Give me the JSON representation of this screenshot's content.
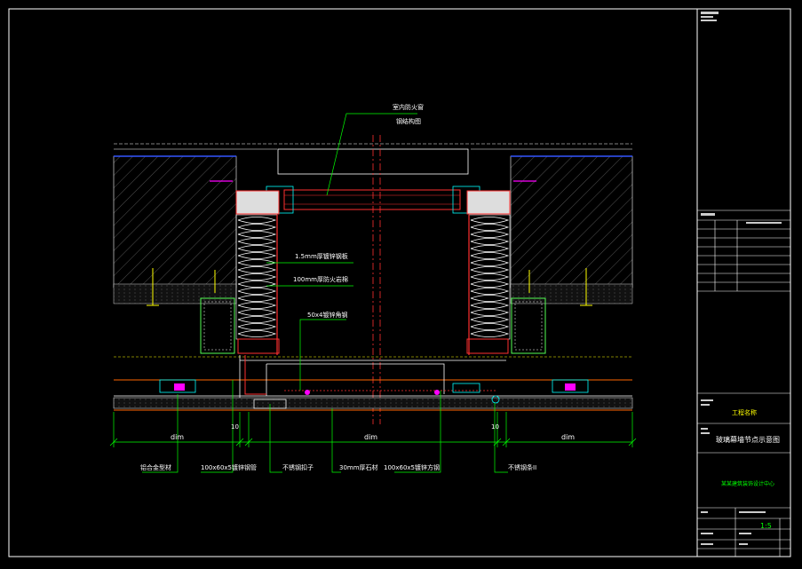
{
  "labels": {
    "top_a": "室内防火窗",
    "top_b": "钢结构图",
    "steel_plate": "1.5mm厚镀锌钢板",
    "fire_cotton": "100mm厚防火岩棉",
    "angle": "50x4镀锌角钢"
  },
  "dims": {
    "left": "dim",
    "mid": "dim",
    "right": "dim",
    "ten_left": "10",
    "ten_right": "10"
  },
  "bottom_labels": [
    "铝合金型材",
    "100x60x5镀锌钢管",
    "不锈钢扣子",
    "30mm厚石材",
    "100x60x5镀锌方钢",
    "不锈钢条II"
  ],
  "title_block": {
    "drawing_name": "玻璃幕墙节点示意图",
    "project": "工程名称",
    "company": "某某建筑装饰设计中心",
    "scale": "1:5"
  },
  "colors": {
    "background": "#000000",
    "frame": "#ffffff",
    "dim": "#00ff00",
    "leader": "#00ff00",
    "hatch": "#ffffff",
    "insulation": "#ffffff",
    "steel": "#ff0000",
    "accent_blue": "#0000ff",
    "cyan": "#00ffff",
    "magenta": "#ff00ff",
    "yellow": "#ffff00"
  }
}
